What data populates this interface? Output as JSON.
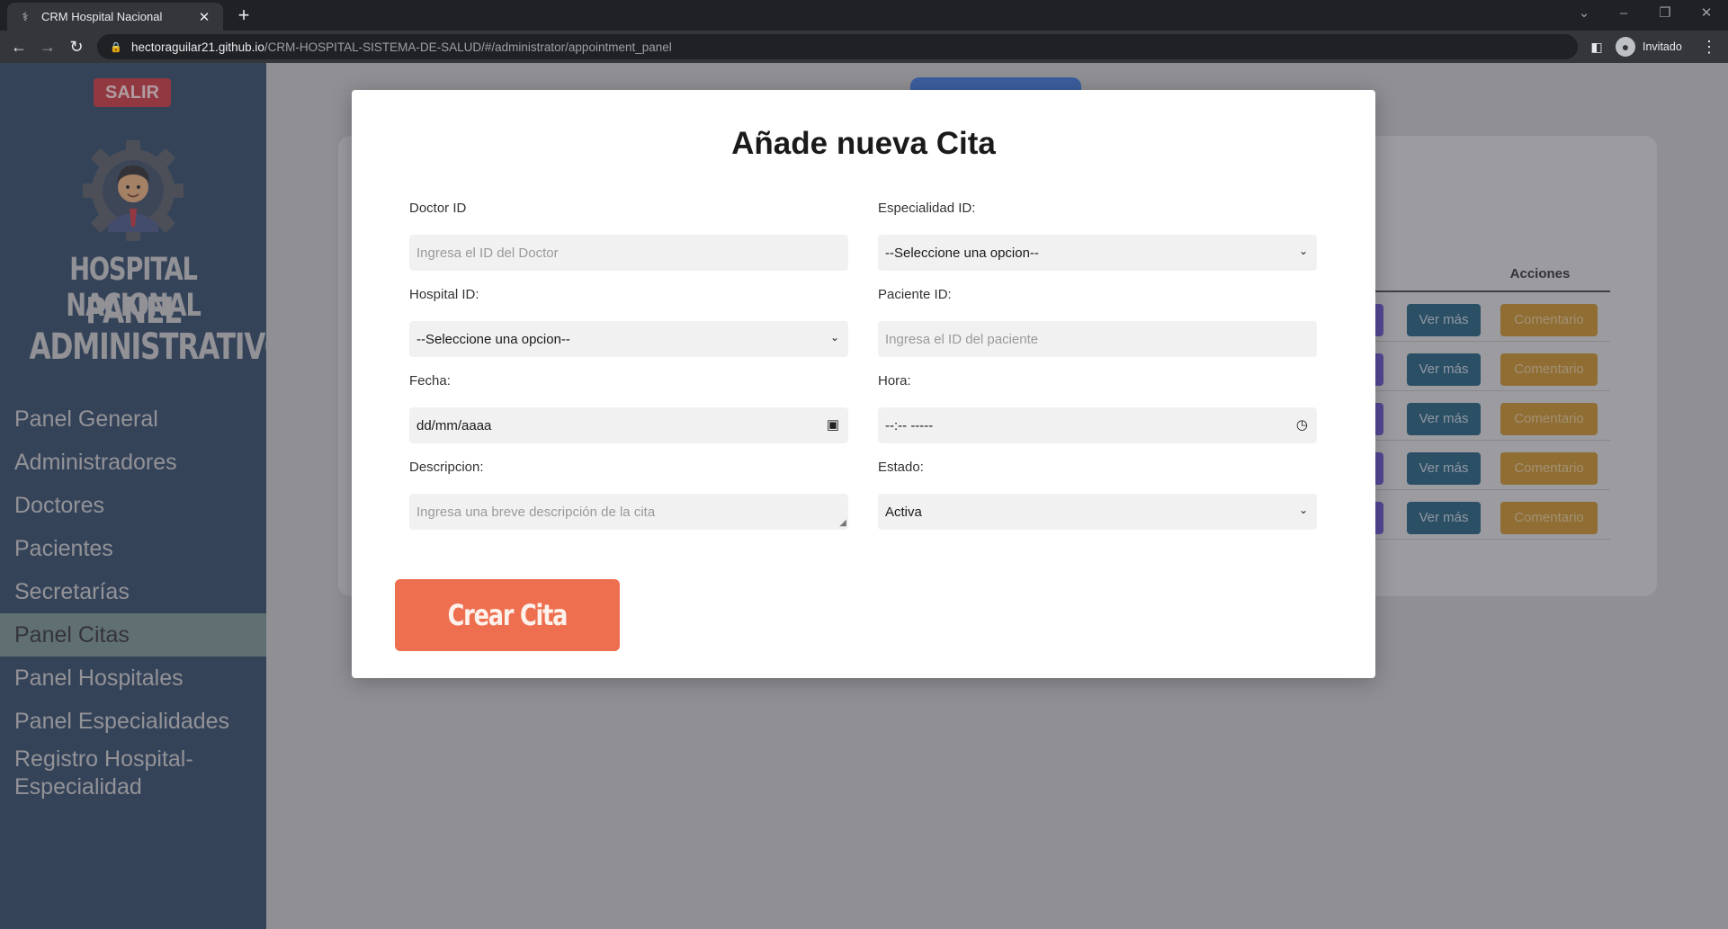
{
  "browser": {
    "tab_title": "CRM Hospital Nacional",
    "url_host": "hectoraguilar21.github.io",
    "url_path": "/CRM-HOSPITAL-SISTEMA-DE-SALUD/#/administrator/appointment_panel",
    "profile": "Invitado"
  },
  "sidebar": {
    "logout": "SALIR",
    "brand_line1": "HOSPITAL NACIONAL",
    "brand_line2": "PANEL",
    "brand_line3": "ADMINISTRATIVO",
    "items": [
      {
        "label": "Panel General"
      },
      {
        "label": "Administradores"
      },
      {
        "label": "Doctores"
      },
      {
        "label": "Pacientes"
      },
      {
        "label": "Secretarías"
      },
      {
        "label": "Panel Citas",
        "active": true
      },
      {
        "label": "Panel Hospitales"
      },
      {
        "label": "Panel Especialidades"
      },
      {
        "label": "Registro Hospital-Especialidad"
      }
    ]
  },
  "table": {
    "header_actions": "Acciones",
    "rows": [
      {
        "ver": "Ver más",
        "comentario": "Comentario"
      },
      {
        "ver": "Ver más",
        "comentario": "Comentario"
      },
      {
        "ver": "Ver más",
        "comentario": "Comentario"
      },
      {
        "ver": "Ver más",
        "comentario": "Comentario"
      },
      {
        "ver": "Ver más",
        "comentario": "Comentario"
      }
    ]
  },
  "modal": {
    "title": "Añade nueva Cita",
    "doctor_label": "Doctor ID",
    "doctor_placeholder": "Ingresa el ID del Doctor",
    "especialidad_label": "Especialidad ID:",
    "especialidad_value": "--Seleccione una opcion--",
    "hospital_label": "Hospital ID:",
    "hospital_value": "--Seleccione una opcion--",
    "paciente_label": "Paciente ID:",
    "paciente_placeholder": "Ingresa el ID del paciente",
    "fecha_label": "Fecha:",
    "fecha_value": "dd/mm/aaaa",
    "hora_label": "Hora:",
    "hora_value": "--:-- -----",
    "descripcion_label": "Descripcion:",
    "descripcion_placeholder": "Ingresa una breve descripción de la cita",
    "estado_label": "Estado:",
    "estado_value": "Activa",
    "submit": "Crear Cita"
  },
  "colors": {
    "sidebar_bg": "#1f3a58",
    "active_item": "#6d8a85",
    "logout": "#c8262c",
    "submit": "#ee6f4f",
    "ver_button": "#0e4f6e",
    "comentario_button": "#c48513"
  }
}
